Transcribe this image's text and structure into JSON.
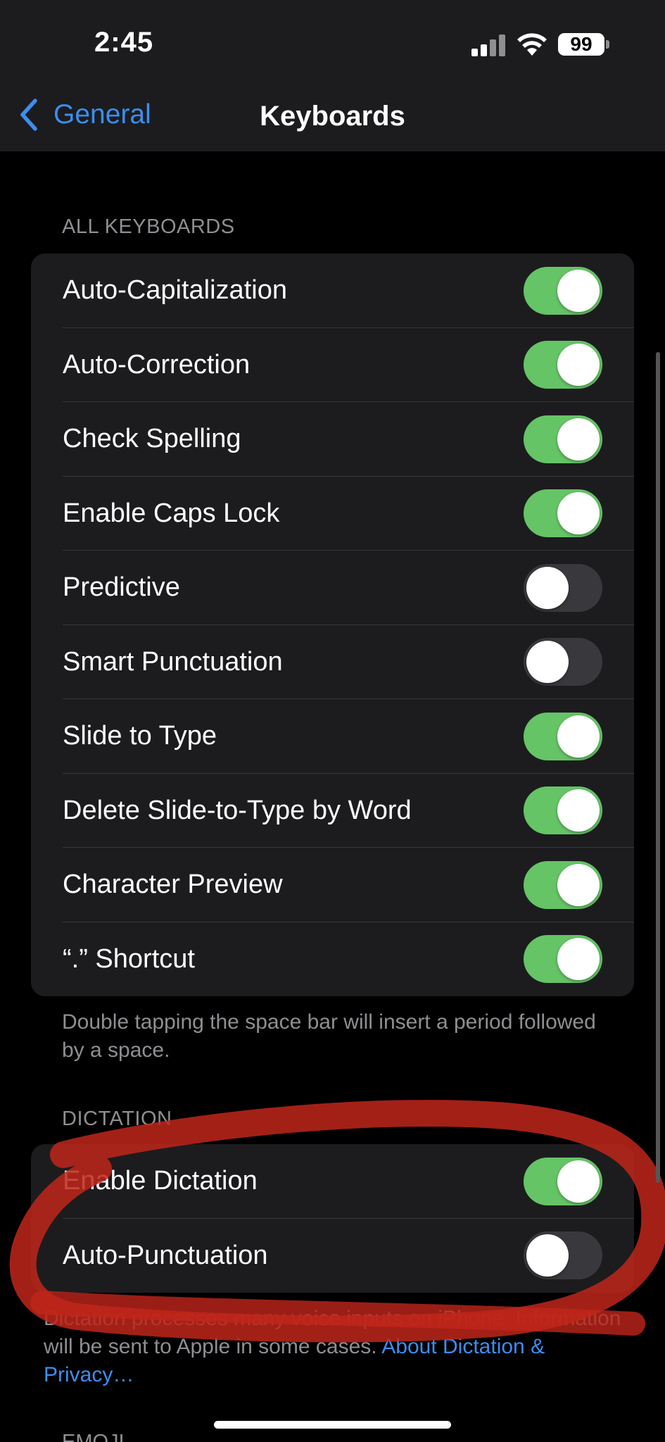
{
  "status_bar": {
    "time": "2:45",
    "battery": "99",
    "signal_icon": "cellular-signal-icon",
    "wifi_icon": "wifi-icon"
  },
  "nav": {
    "back_label": "General",
    "title": "Keyboards"
  },
  "all_keyboards": {
    "header": "ALL KEYBOARDS",
    "rows": [
      {
        "label": "Auto-Capitalization",
        "on": true
      },
      {
        "label": "Auto-Correction",
        "on": true
      },
      {
        "label": "Check Spelling",
        "on": true
      },
      {
        "label": "Enable Caps Lock",
        "on": true
      },
      {
        "label": "Predictive",
        "on": false
      },
      {
        "label": "Smart Punctuation",
        "on": false
      },
      {
        "label": "Slide to Type",
        "on": true
      },
      {
        "label": "Delete Slide-to-Type by Word",
        "on": true
      },
      {
        "label": "Character Preview",
        "on": true
      },
      {
        "label": "“.” Shortcut",
        "on": true
      }
    ],
    "footer": "Double tapping the space bar will insert a period followed by a space."
  },
  "dictation": {
    "header": "DICTATION",
    "rows": [
      {
        "label": "Enable Dictation",
        "on": true
      },
      {
        "label": "Auto-Punctuation",
        "on": false
      }
    ],
    "footer_text": "Dictation processes many voice inputs on iPhone. Information will be sent to Apple in some cases.",
    "footer_link": "About Dictation & Privacy…"
  },
  "next_section_header": "EMOJI",
  "colors": {
    "accent": "#3b8ef0",
    "toggle_on": "#65c466",
    "toggle_off": "#39393d",
    "annotation": "#c0261a"
  }
}
